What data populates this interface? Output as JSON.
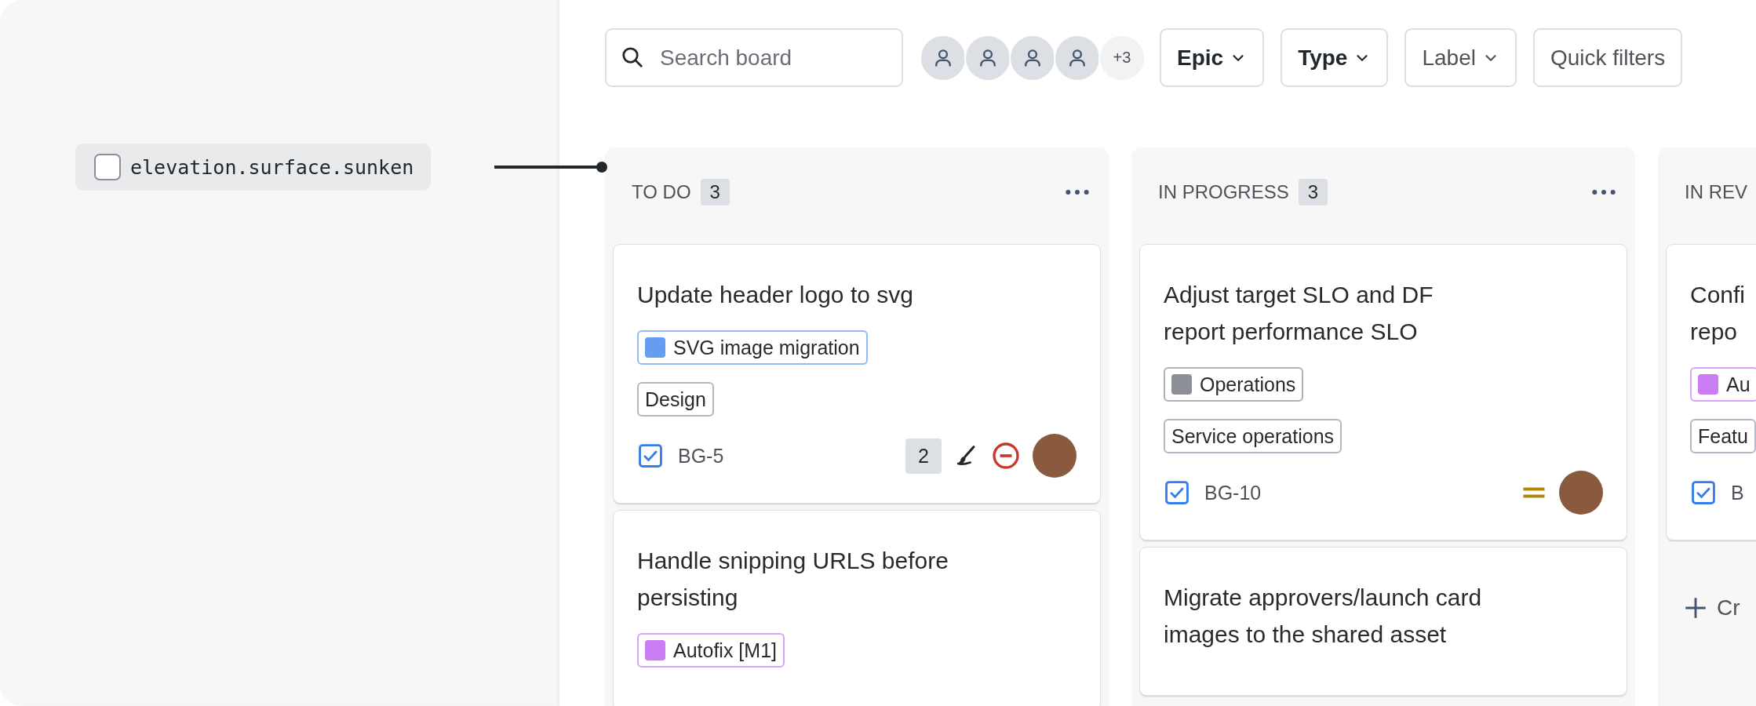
{
  "annotation": {
    "label": "elevation.surface.sunken"
  },
  "toolbar": {
    "search": {
      "placeholder": "Search board"
    },
    "avatars": [
      {
        "kind": "person"
      },
      {
        "kind": "person"
      },
      {
        "kind": "person"
      },
      {
        "kind": "person"
      }
    ],
    "more_people": "+3",
    "filters": [
      {
        "label": "Epic",
        "active": true,
        "dropdown": true
      },
      {
        "label": "Type",
        "active": true,
        "dropdown": true
      },
      {
        "label": "Label",
        "active": false,
        "dropdown": true
      },
      {
        "label": "Quick filters",
        "active": false,
        "dropdown": false
      }
    ]
  },
  "columns": [
    {
      "title": "TO DO",
      "count": "3",
      "menu": true,
      "cards": [
        {
          "title": "Update header logo to svg",
          "tags": [
            {
              "label": "SVG image migration",
              "color": "#669df1"
            },
            {
              "label": "Design"
            }
          ],
          "key": "BG-5",
          "footer": [
            {
              "kind": "estimate",
              "text": "2"
            },
            {
              "kind": "brush"
            },
            {
              "kind": "blocker"
            },
            {
              "kind": "avatar"
            }
          ]
        },
        {
          "title": "Handle snipping URLS before persisting",
          "tags": [
            {
              "label": "Autofix [M1]",
              "color": "#c97cf4"
            }
          ]
        }
      ]
    },
    {
      "title": "IN PROGRESS",
      "count": "3",
      "menu": true,
      "cards": [
        {
          "title": "Adjust target SLO and DF report performance SLO",
          "tags": [
            {
              "label": "Operations",
              "color": "#8c8f97"
            },
            {
              "label": "Service operations"
            }
          ],
          "key": "BG-10",
          "footer": [
            {
              "kind": "medium"
            },
            {
              "kind": "avatar"
            }
          ]
        },
        {
          "title": "Migrate approvers/launch card images to the shared asset"
        }
      ]
    },
    {
      "title": "IN REV",
      "menu": false,
      "create": "Cr",
      "cards": [
        {
          "title": "Confi\nrepo",
          "tags": [
            {
              "label": "Au",
              "color": "#c97cf4"
            },
            {
              "label": "Featu"
            }
          ],
          "key": "B"
        }
      ]
    }
  ]
}
